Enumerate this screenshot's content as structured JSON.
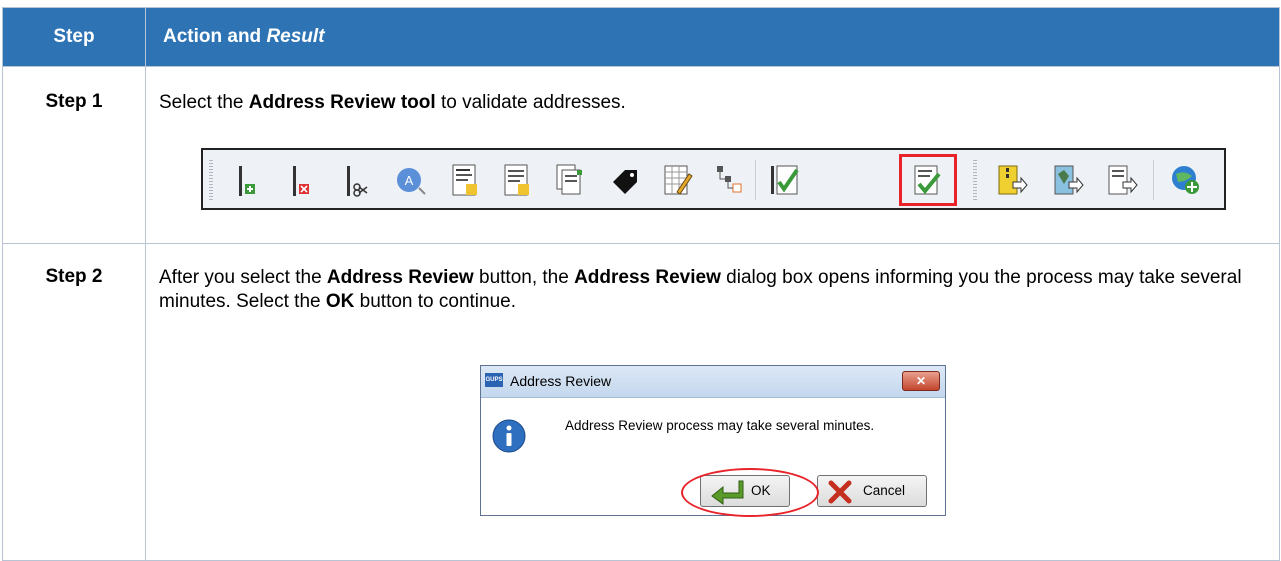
{
  "table": {
    "header": {
      "step": "Step",
      "action_prefix": "Action and ",
      "action_italic": "Result"
    },
    "rows": [
      {
        "step": "Step 1",
        "parts": [
          "Select the ",
          "Address Review tool",
          " to validate addresses."
        ]
      },
      {
        "step": "Step 2",
        "parts": [
          "After you select the ",
          "Address Review",
          " button, the ",
          "Address Review",
          " dialog box opens informing you the process may take several minutes. Select the ",
          "OK",
          " button to continue."
        ]
      }
    ]
  },
  "toolbar": {
    "buttons": [
      "add-line-icon",
      "delete-line-icon",
      "split-line-icon",
      "address-tool-icon",
      "new-record-icon",
      "new-list-icon",
      "copy-records-icon",
      "tag-icon",
      "edit-table-icon",
      "hierarchy-icon",
      "review-check-icon",
      "address-review-icon",
      "export-zip-icon",
      "export-map-icon",
      "export-list-icon",
      "add-globe-icon"
    ],
    "highlighted": "address-review-icon",
    "highlight_color": "#e8242a"
  },
  "dialog": {
    "title_icon": "GUPS",
    "title": "Address Review",
    "close_label": "✕",
    "message": "Address Review process may take several minutes.",
    "ok_label": "OK",
    "cancel_label": "Cancel"
  },
  "colors": {
    "header_bg": "#2e74b5",
    "highlight": "#e8242a"
  }
}
